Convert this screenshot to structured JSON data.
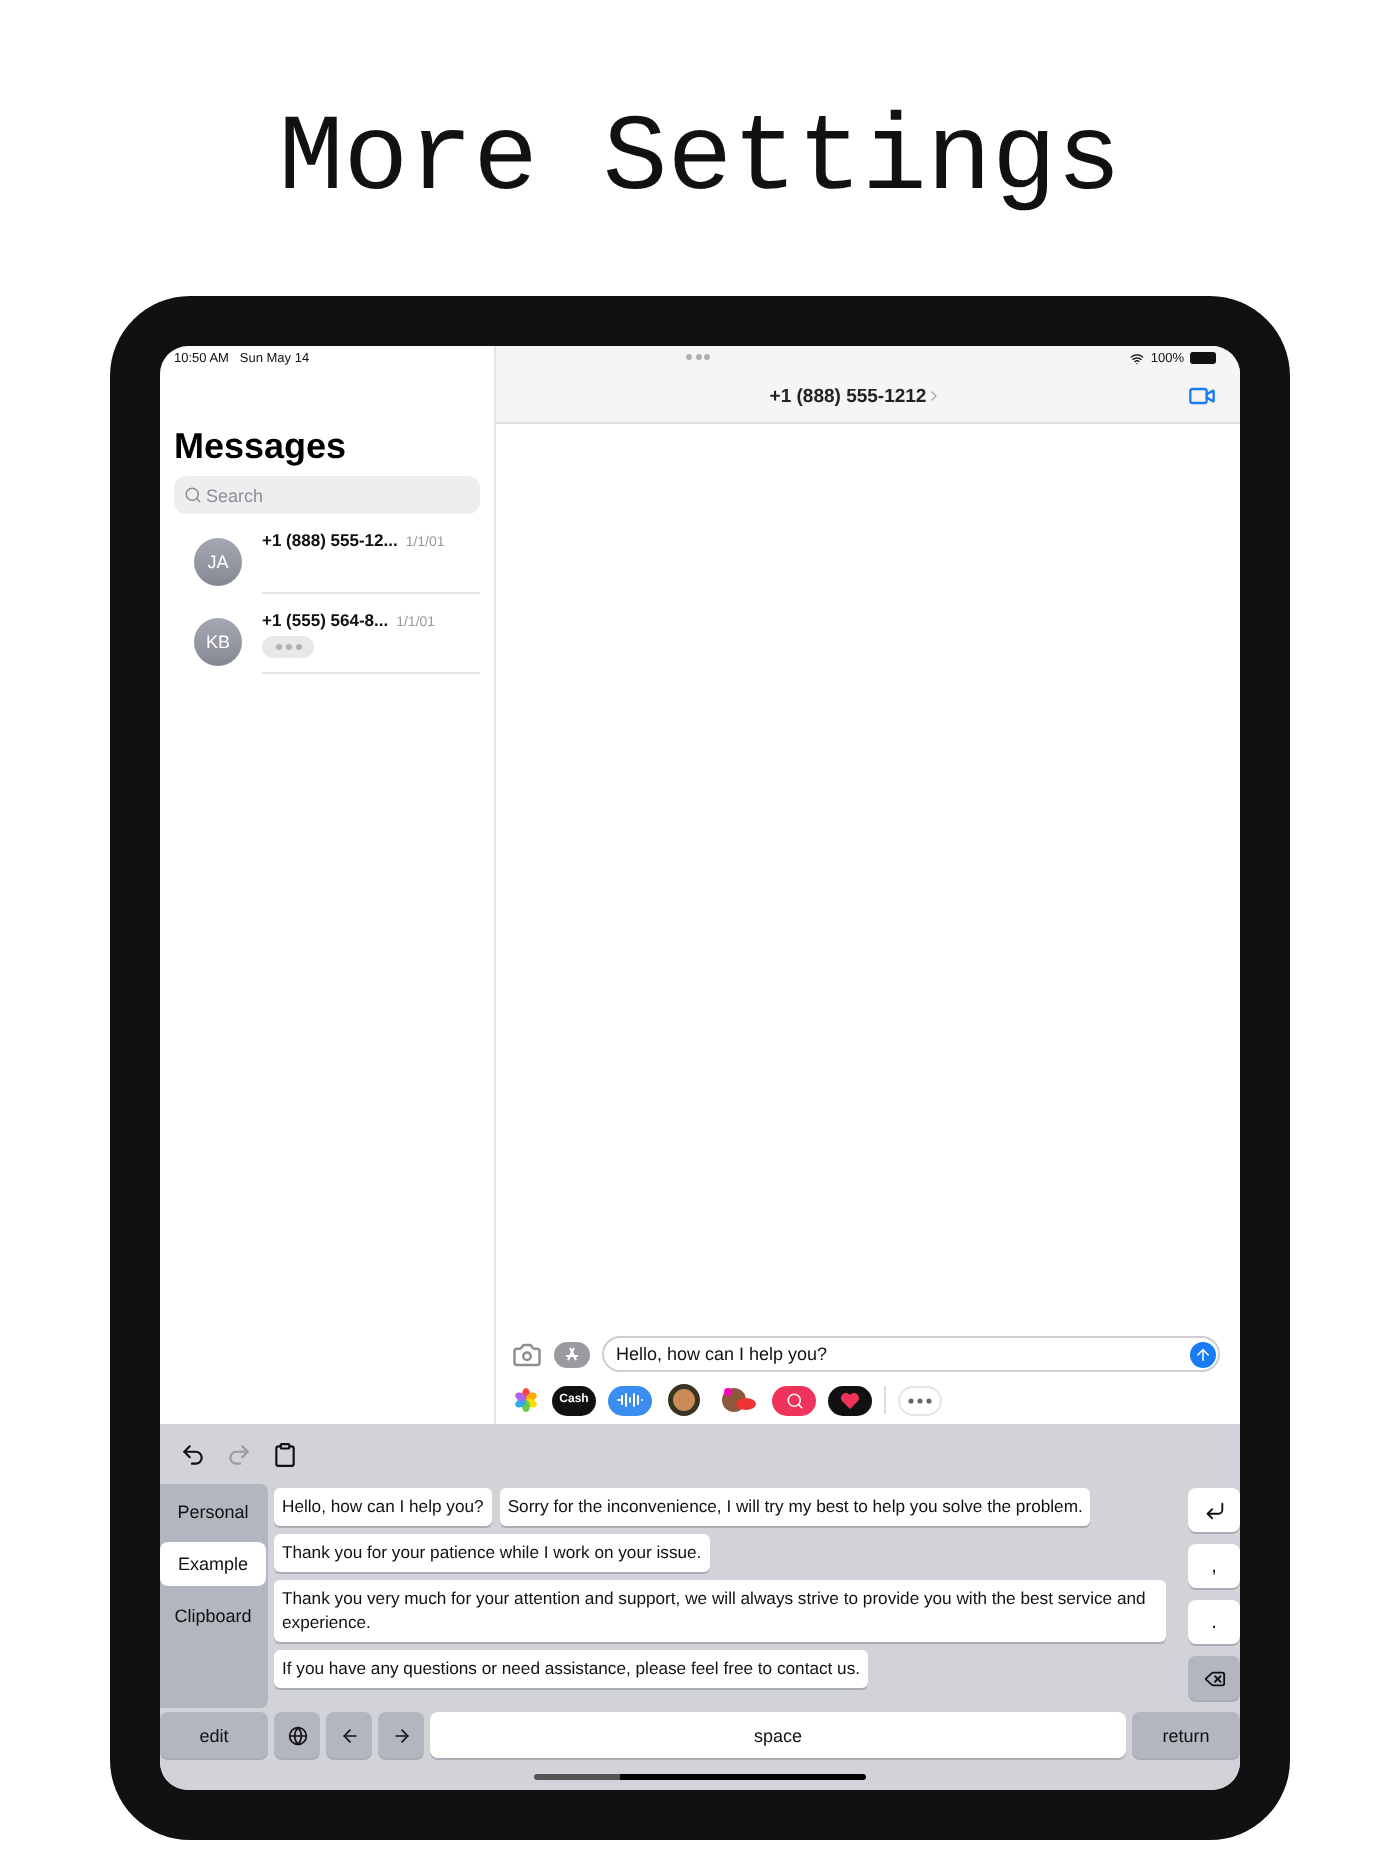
{
  "heading": "More Settings",
  "status_bar": {
    "time": "10:50 AM",
    "date": "Sun May 14",
    "battery": "100%"
  },
  "sidebar": {
    "title": "Messages",
    "search": {
      "placeholder": "Search"
    },
    "conversations": [
      {
        "initials": "JA",
        "name": "+1 (888) 555-12...",
        "date": "1/1/01",
        "typing": false
      },
      {
        "initials": "KB",
        "name": "+1 (555) 564-8...",
        "date": "1/1/01",
        "typing": true
      }
    ]
  },
  "chat": {
    "title": "+1 (888) 555-1212",
    "input": {
      "value": "Hello, how can I help you?"
    },
    "apps": [
      {
        "kind": "photos"
      },
      {
        "kind": "cash",
        "label": "Cash"
      },
      {
        "kind": "audio"
      },
      {
        "kind": "memoji"
      },
      {
        "kind": "stickers"
      },
      {
        "kind": "search"
      },
      {
        "kind": "heart"
      },
      {
        "kind": "more"
      }
    ]
  },
  "keyboard": {
    "tabs": [
      {
        "label": "Personal",
        "selected": false
      },
      {
        "label": "Example",
        "selected": true
      },
      {
        "label": "Clipboard",
        "selected": false
      }
    ],
    "phrases": [
      "Hello, how can I help you?",
      "Sorry for the inconvenience, I will try my best to help you solve the problem.",
      "Thank you for your patience while I work on your issue.",
      "Thank you very much for your attention and support, we will always strive to provide you with the best service and experience.",
      "If you have any questions or need assistance, please feel free to contact us."
    ],
    "side_keys": [
      {
        "kind": "enter"
      },
      {
        "kind": "char",
        "label": ","
      },
      {
        "kind": "char",
        "label": "."
      },
      {
        "kind": "delete"
      }
    ],
    "bottom_keys": [
      {
        "kind": "text",
        "label": "edit",
        "dark": true
      },
      {
        "kind": "globe",
        "dark": true
      },
      {
        "kind": "left",
        "dark": true
      },
      {
        "kind": "right",
        "dark": true
      },
      {
        "kind": "space",
        "label": "space",
        "dark": false
      },
      {
        "kind": "text",
        "label": "return",
        "dark": true
      }
    ]
  }
}
